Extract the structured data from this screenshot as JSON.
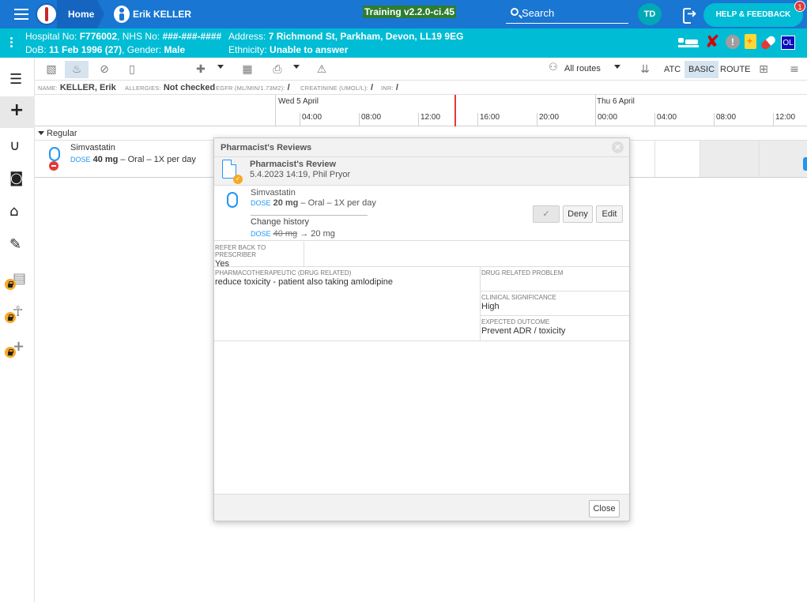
{
  "topbar": {
    "home_label": "Home",
    "patient_label": "Erik KELLER",
    "training_label": "Training v2.2.0-ci.45",
    "search_label": "Search",
    "avatar_initials": "TD",
    "help_label": "HELP & FEEDBACK",
    "help_badge": "1",
    "colors": {
      "bar": "#1976d2",
      "banner": "#00bcd4",
      "accent": "#00bcd4"
    }
  },
  "banner": {
    "hospital_key": "Hospital No:",
    "hospital_val": "F776002",
    "nhs_key": ", NHS No:",
    "nhs_val": "###-###-####",
    "dob_key": "DoB:",
    "dob_val": "11 Feb 1996 (27)",
    "gender_key": ", Gender:",
    "gender_val": "Male",
    "address_key": "Address:",
    "address_val": "7 Richmond St, Parkham, Devon, LL19 9EG",
    "ethnicity_key": "Ethnicity:",
    "ethnicity_val": "Unable to answer",
    "ol_label": "OL"
  },
  "toolbar": {
    "routes_label": "All routes",
    "atc_label": "ATC",
    "basic_label": "BASIC",
    "route_label": "ROUTE"
  },
  "info": {
    "name_key": "NAME:",
    "name_val": "KELLER, Erik",
    "allergies_key": "ALLERGIES:",
    "allergies_val": "Not checked",
    "egfr_key": "EGFR (ML/MIN/1.73M2):",
    "egfr_val": "/",
    "creatinine_key": "CREATININE (UMOL/L):",
    "creatinine_val": "/",
    "inr_key": "INR:",
    "inr_val": "/"
  },
  "timeline": {
    "day1": "Wed 5 April",
    "day2": "Thu 6 April",
    "hours": [
      "04:00",
      "08:00",
      "12:00",
      "16:00",
      "20:00",
      "00:00",
      "04:00",
      "08:00",
      "12:00"
    ]
  },
  "group_label": "Regular",
  "med": {
    "name": "Simvastatin",
    "dose_key": "DOSE",
    "dose_val": "40 mg",
    "dose_rest": " – Oral – 1X per day"
  },
  "modal": {
    "title": "Pharmacist's Reviews",
    "review_title": "Pharmacist's Review",
    "review_meta": "5.4.2023 14:19, Phil Pryor",
    "drug_name": "Simvastatin",
    "dose_key": "DOSE",
    "dose_val": "20 mg",
    "dose_rest": " – Oral – 1X per day",
    "history_title": "Change history",
    "history_key": "DOSE",
    "history_old": "40 mg",
    "history_arrow": "→",
    "history_new": "20 mg",
    "approve_glyph": "✓",
    "deny_label": "Deny",
    "edit_label": "Edit",
    "refer_label": "REFER BACK TO PRESCRIBER",
    "refer_val": "Yes",
    "pharma_label": "PHARMACOTHERAPEUTIC (DRUG RELATED)",
    "pharma_val": "reduce toxicity - patient also taking amlodipine",
    "drp_label": "DRUG RELATED PROBLEM",
    "drp_val": "",
    "clin_label": "CLINICAL SIGNIFICANCE",
    "clin_val": "High",
    "outcome_label": "EXPECTED OUTCOME",
    "outcome_val": "Prevent ADR / toxicity",
    "close_label": "Close"
  }
}
